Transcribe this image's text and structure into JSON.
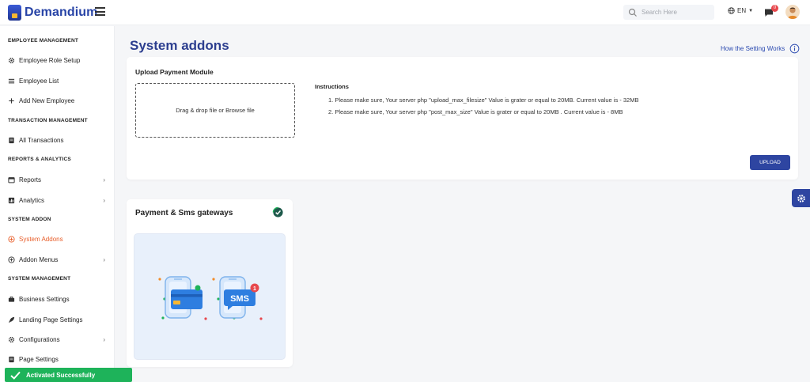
{
  "header": {
    "brand": "Demandium",
    "search_placeholder": "Search Here",
    "language": "EN",
    "notification_count": "0"
  },
  "sidebar": {
    "sections": [
      {
        "title": "EMPLOYEE MANAGEMENT"
      },
      {
        "title": "TRANSACTION MANAGEMENT"
      },
      {
        "title": "REPORTS & ANALYTICS"
      },
      {
        "title": "SYSTEM ADDON"
      },
      {
        "title": "SYSTEM MANAGEMENT"
      }
    ],
    "items": [
      {
        "label": "Employee Role Setup",
        "icon": "gear-icon"
      },
      {
        "label": "Employee List",
        "icon": "list-icon"
      },
      {
        "label": "Add New Employee",
        "icon": "plus-icon"
      },
      {
        "label": "All Transactions",
        "icon": "document-icon"
      },
      {
        "label": "Reports",
        "icon": "calendar-icon"
      },
      {
        "label": "Analytics",
        "icon": "chart-icon"
      },
      {
        "label": "System Addons",
        "icon": "addon-icon",
        "active": true
      },
      {
        "label": "Addon Menus",
        "icon": "plus-circle-icon"
      },
      {
        "label": "Business Settings",
        "icon": "briefcase-icon"
      },
      {
        "label": "Landing Page Settings",
        "icon": "rocket-icon"
      },
      {
        "label": "Configurations",
        "icon": "gear-icon"
      },
      {
        "label": "Page Settings",
        "icon": "document-icon"
      }
    ]
  },
  "main": {
    "title": "System addons",
    "how_link": "How the Setting Works",
    "upload": {
      "title": "Upload Payment Module",
      "dropzone_text": "Drag & drop file or Browse file",
      "instructions_title": "Instructions",
      "instructions": [
        "1. Please make sure, Your server php \"upload_max_filesize\" Value is grater or equal to 20MB. Current value is - 32MB",
        "2. Please make sure, Your server php \"post_max_size\" Value is grater or equal to 20MB . Current value is - 8MB"
      ],
      "button": "UPLOAD"
    },
    "gateway": {
      "title": "Payment & Sms gateways",
      "sms_label": "SMS",
      "sms_badge": "1"
    }
  },
  "toast": {
    "message": "Activated Successfully"
  },
  "colors": {
    "primary": "#2e45a1",
    "active": "#e85e2a",
    "success": "#1eb35a",
    "badge": "#e7484d"
  }
}
